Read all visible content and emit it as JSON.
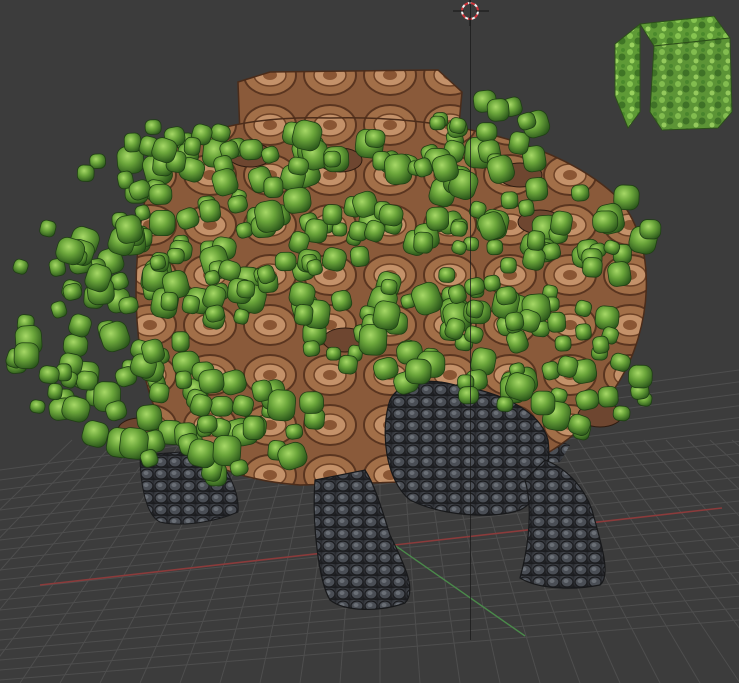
{
  "viewport": {
    "background": "#3c3c3c",
    "grid_color": "#4e4e4e",
    "x_axis_color": "#8b3b3b",
    "y_axis_color": "#4a8a4a"
  },
  "model": {
    "shell_color": "#8a5a3a",
    "foliage_color": "#5f9a34",
    "skin_color": "#3a3d42"
  },
  "icons": {
    "cursor": "3d-cursor-icon",
    "thumbnail": "material-preview-icon"
  }
}
